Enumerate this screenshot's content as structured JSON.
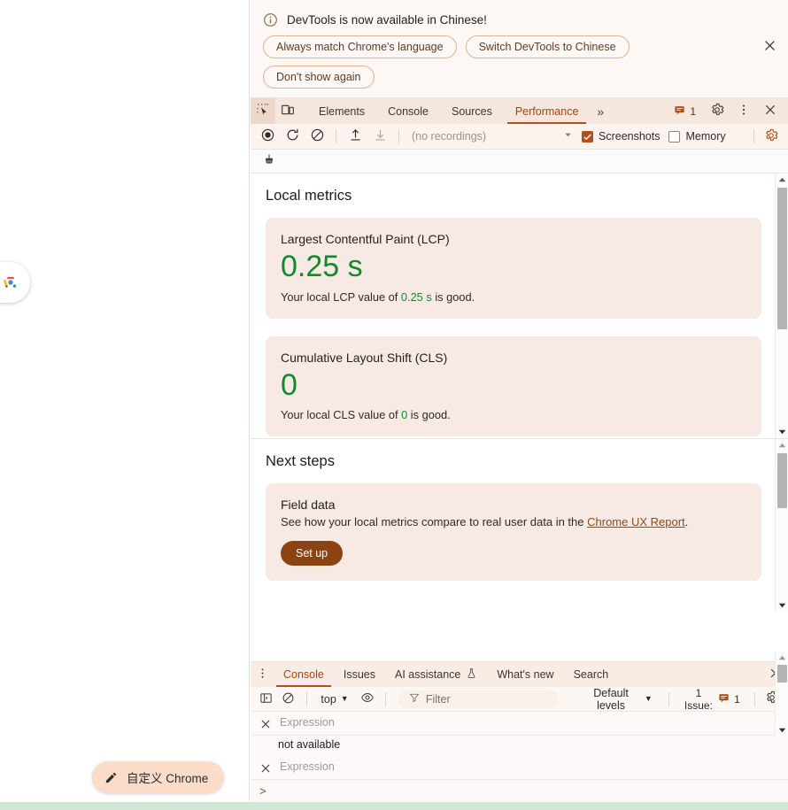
{
  "page": {
    "lens_icon": "google-lens-icon",
    "customize_button": {
      "label": "自定义 Chrome",
      "icon": "pencil-icon"
    }
  },
  "infobar": {
    "icon": "info-circle-icon",
    "message": "DevTools is now available in Chinese!",
    "buttons": [
      {
        "label": "Always match Chrome's language"
      },
      {
        "label": "Switch DevTools to Chinese"
      },
      {
        "label": "Don't show again"
      }
    ],
    "close_icon": "close-icon"
  },
  "tabbar": {
    "inspect_icon": "inspect-element-icon",
    "device_icon": "device-toolbar-icon",
    "tabs": [
      {
        "label": "Elements",
        "active": false
      },
      {
        "label": "Console",
        "active": false
      },
      {
        "label": "Sources",
        "active": false
      },
      {
        "label": "Performance",
        "active": true
      }
    ],
    "more_tabs_icon": "chevron-double-right-icon",
    "issues_badge": {
      "icon": "issue-flag-icon",
      "count": "1"
    },
    "settings_icon": "gear-icon",
    "menu_icon": "three-dots-vertical-icon",
    "close_icon": "close-icon"
  },
  "perfbar": {
    "record_icon": "record-circle-icon",
    "reload_record_icon": "reload-record-icon",
    "clear_icon": "clear-slash-icon",
    "upload_icon": "upload-arrow-icon",
    "download_icon": "download-arrow-icon",
    "recordings_value": "(no recordings)",
    "recordings_caret": "chevron-down-icon",
    "screenshots": {
      "label": "Screenshots",
      "checked": true
    },
    "memory": {
      "label": "Memory",
      "checked": false
    },
    "capture_settings_icon": "capture-settings-gear-icon",
    "cleanup_icon": "broom-icon"
  },
  "local_metrics": {
    "title": "Local metrics",
    "cards": [
      {
        "name": "Largest Contentful Paint (LCP)",
        "value": "0.25 s",
        "desc_prefix": "Your local LCP value of ",
        "desc_value": "0.25 s",
        "desc_suffix": " is good."
      },
      {
        "name": "Cumulative Layout Shift (CLS)",
        "value": "0",
        "desc_prefix": "Your local CLS value of ",
        "desc_value": "0",
        "desc_suffix": " is good."
      }
    ]
  },
  "next_steps": {
    "title": "Next steps",
    "card": {
      "name": "Field data",
      "desc_prefix": "See how your local metrics compare to real user data in the ",
      "link": "Chrome UX Report",
      "desc_suffix": ".",
      "button": "Set up"
    }
  },
  "drawer": {
    "menu_icon": "three-dots-vertical-icon",
    "tabs": [
      {
        "label": "Console",
        "active": true,
        "icon": ""
      },
      {
        "label": "Issues",
        "active": false,
        "icon": ""
      },
      {
        "label": "AI assistance",
        "active": false,
        "icon": "flask-icon"
      },
      {
        "label": "What's new",
        "active": false,
        "icon": ""
      },
      {
        "label": "Search",
        "active": false,
        "icon": ""
      }
    ],
    "close_icon": "close-icon"
  },
  "console_toolbar": {
    "sidebar_icon": "console-sidebar-icon",
    "clear_icon": "clear-slash-icon",
    "context": "top",
    "context_caret": "chevron-down-icon",
    "eye_icon": "live-expression-eye-icon",
    "filter": {
      "icon": "filter-funnel-icon",
      "placeholder": "Filter",
      "value": ""
    },
    "levels": "Default levels",
    "levels_caret": "chevron-down-icon",
    "issues": {
      "label": "1 Issue:",
      "icon": "issue-flag-icon",
      "count": "1"
    },
    "settings_icon": "gear-icon"
  },
  "console_body": {
    "messages": [
      {
        "close_icon": "close-icon",
        "expression": "Expression",
        "detail": "not available"
      },
      {
        "close_icon": "close-icon",
        "expression": "Expression",
        "detail": ""
      }
    ],
    "prompt_caret": ">"
  },
  "colors": {
    "accent": "#b2501b",
    "good_green": "#14892c",
    "card_bg": "#f7e9e4",
    "tabbar_bg": "#f6e7de",
    "link": "#8a4b1d",
    "setup_button": "#8c4312",
    "customize_button": "#fadcc9",
    "bottom_strip": "#cfe7d4"
  }
}
